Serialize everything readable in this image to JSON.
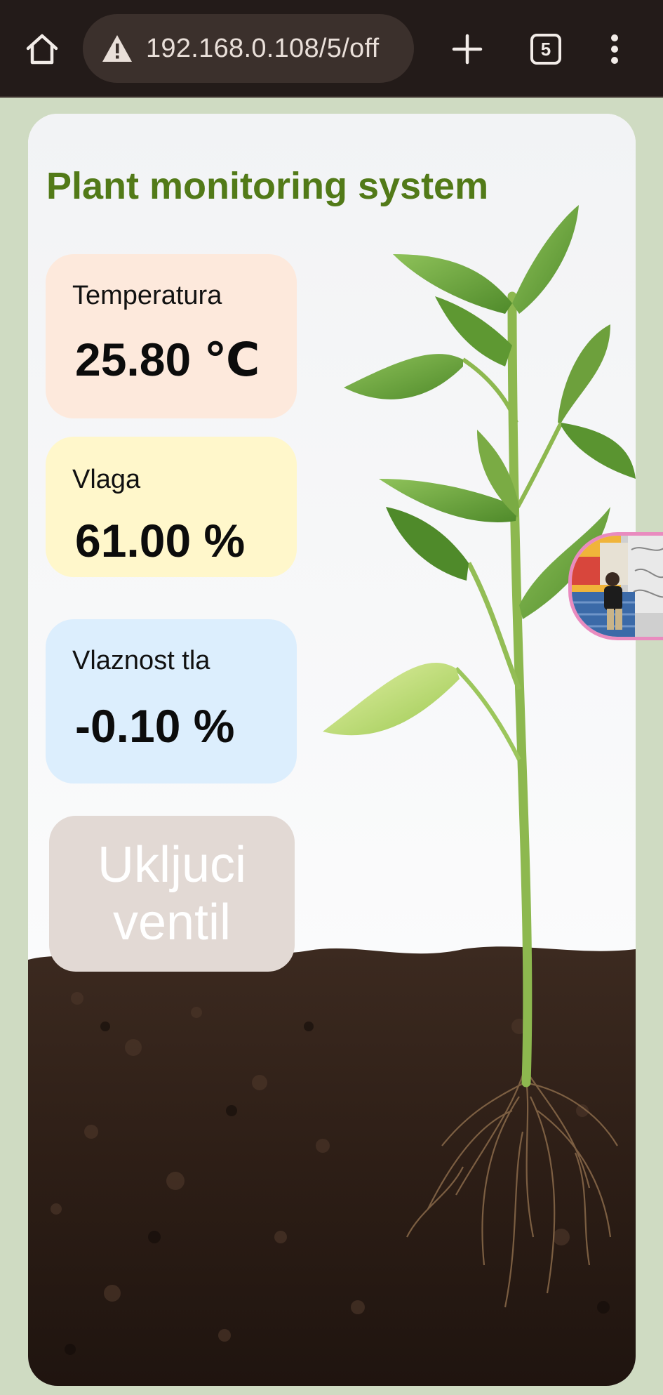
{
  "browser": {
    "url": "192.168.0.108/5/off",
    "tab_count": "5",
    "icons": {
      "home": "home-icon",
      "security_warning": "warning-triangle-icon",
      "new_tab": "plus-icon",
      "tabs": "tab-switcher-icon",
      "menu": "kebab-menu-icon"
    }
  },
  "page": {
    "title": "Plant monitoring system",
    "cards": [
      {
        "label": "Temperatura",
        "value": "25.80 ℃",
        "bg": "#fde9dc"
      },
      {
        "label": "Vlaga",
        "value": "61.00 %",
        "bg": "#fff7cb"
      },
      {
        "label": "Vlaznost tla",
        "value": "-0.10 %",
        "bg": "#dceefd"
      }
    ],
    "valve_button": {
      "label_line1": "Ukljuci",
      "label_line2": "ventil"
    }
  },
  "colors": {
    "page_background": "#cfdbc2",
    "toolbar": "#231b19",
    "title": "#527a18"
  }
}
